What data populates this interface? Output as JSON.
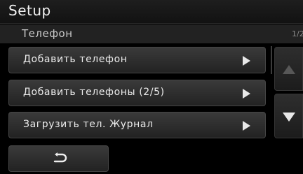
{
  "header": {
    "title": "Setup"
  },
  "subheader": {
    "title": "Телефон",
    "page_indicator": "1/2"
  },
  "menu": {
    "items": [
      {
        "label": "Добавить телефон",
        "icon": "play-arrow-icon"
      },
      {
        "label": "Добавить телефоны (2/5)",
        "icon": "play-arrow-icon"
      },
      {
        "label": "Загрузить тел. Журнал",
        "icon": "play-arrow-icon"
      }
    ]
  },
  "scroll": {
    "up_icon": "scroll-up-icon",
    "up_enabled": false,
    "down_icon": "scroll-down-icon",
    "down_enabled": true
  },
  "footer": {
    "back_icon": "back-return-icon"
  },
  "colors": {
    "background": "#000000",
    "text": "#ececec",
    "disabled": "#575757"
  }
}
